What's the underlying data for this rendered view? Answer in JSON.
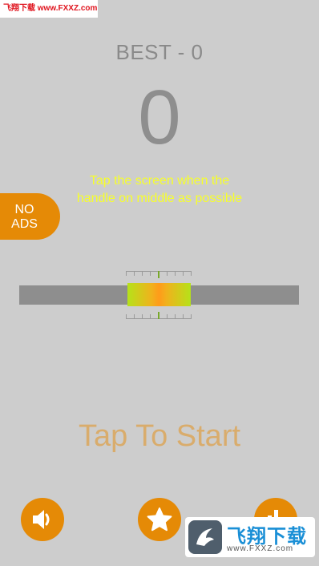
{
  "watermark": {
    "top_text": "飞翔下载 www.FXXZ.com",
    "brand_name": "飞翔下载",
    "brand_url": "www.FXXZ.com"
  },
  "header": {
    "best_label": "BEST - 0",
    "score": "0"
  },
  "instruction": "Tap the screen when the handle on middle as possible",
  "no_ads_button": {
    "line1": "NO",
    "line2": "ADS"
  },
  "meter": {
    "zone_colors": [
      "#b5e21a",
      "#ff9b1a"
    ],
    "track_color": "#8e8e8e"
  },
  "start_prompt": "Tap To Start",
  "bottom_buttons": [
    {
      "icon": "speaker-icon"
    },
    {
      "icon": "star-icon"
    },
    {
      "icon": "leaderboard-icon"
    }
  ],
  "colors": {
    "background": "#cdcdcd",
    "accent": "#e58a06",
    "instruction_text": "#f7ff2a",
    "start_text": "#d9ac6c",
    "score_text": "#8e8e8e"
  }
}
